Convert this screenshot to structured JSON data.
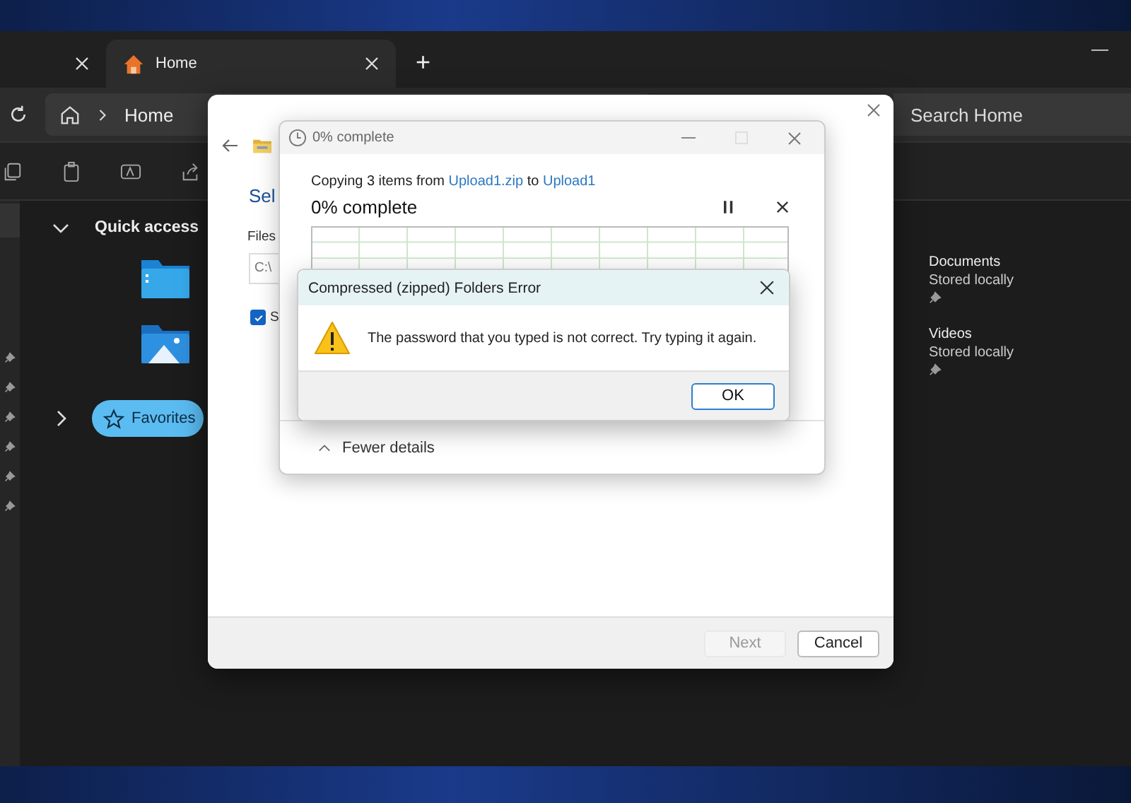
{
  "explorer": {
    "tabs": [
      {
        "selected": false
      },
      {
        "label": "Home",
        "selected": true
      }
    ],
    "new_tab": "+",
    "address": {
      "crumb": "Home"
    },
    "search": {
      "placeholder": "Search Home"
    },
    "nav": {
      "quick_access": {
        "label": "Quick access",
        "expanded": true
      },
      "favorites": {
        "label": "Favorites",
        "expanded": false,
        "selected": true
      }
    },
    "folders": [
      {
        "name": "Documents",
        "status": "Stored locally"
      },
      {
        "name": "Videos",
        "status": "Stored locally"
      }
    ]
  },
  "wizard": {
    "heading": "Sel",
    "files_label": "Files",
    "path_value": "C:\\",
    "checkbox": {
      "label": "S",
      "checked": true
    },
    "buttons": [
      {
        "label": "Next",
        "disabled": true
      },
      {
        "label": "Cancel",
        "disabled": false
      }
    ]
  },
  "progress": {
    "title": "0% complete",
    "line_prefix": "Copying 3 items from ",
    "source": "Upload1.zip",
    "line_mid": " to ",
    "target": "Upload1",
    "status": "0% complete",
    "details_toggle": "Fewer details"
  },
  "error": {
    "title": "Compressed (zipped) Folders Error",
    "message": "The password that you typed is not correct. Try typing it again.",
    "button": "OK"
  }
}
